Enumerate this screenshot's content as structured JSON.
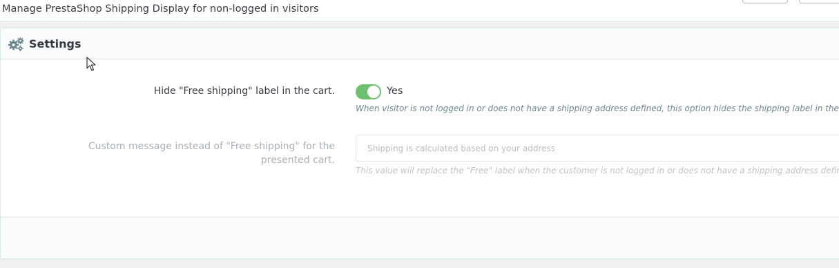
{
  "header": {
    "subtitle": "Manage PrestaShop Shipping Display for non-logged in visitors"
  },
  "panel": {
    "title": "Settings",
    "icon": "gears-icon"
  },
  "form": {
    "hide_label": {
      "label": "Hide \"Free shipping\" label in the cart.",
      "value": "Yes",
      "enabled": true,
      "help": "When visitor is not logged in or does not have a shipping address defined, this option hides the shipping label in the cart."
    },
    "custom_message": {
      "label": "Custom message instead of \"Free shipping\" for the presented cart.",
      "placeholder": "Shipping is calculated based on your address",
      "value": "",
      "help": "This value will replace the \"Free\" label when the customer is not logged in or does not have a shipping address defined."
    }
  },
  "colors": {
    "toggle_on": "#6dc06f",
    "text": "#363a41",
    "help_text": "#6c868e"
  }
}
